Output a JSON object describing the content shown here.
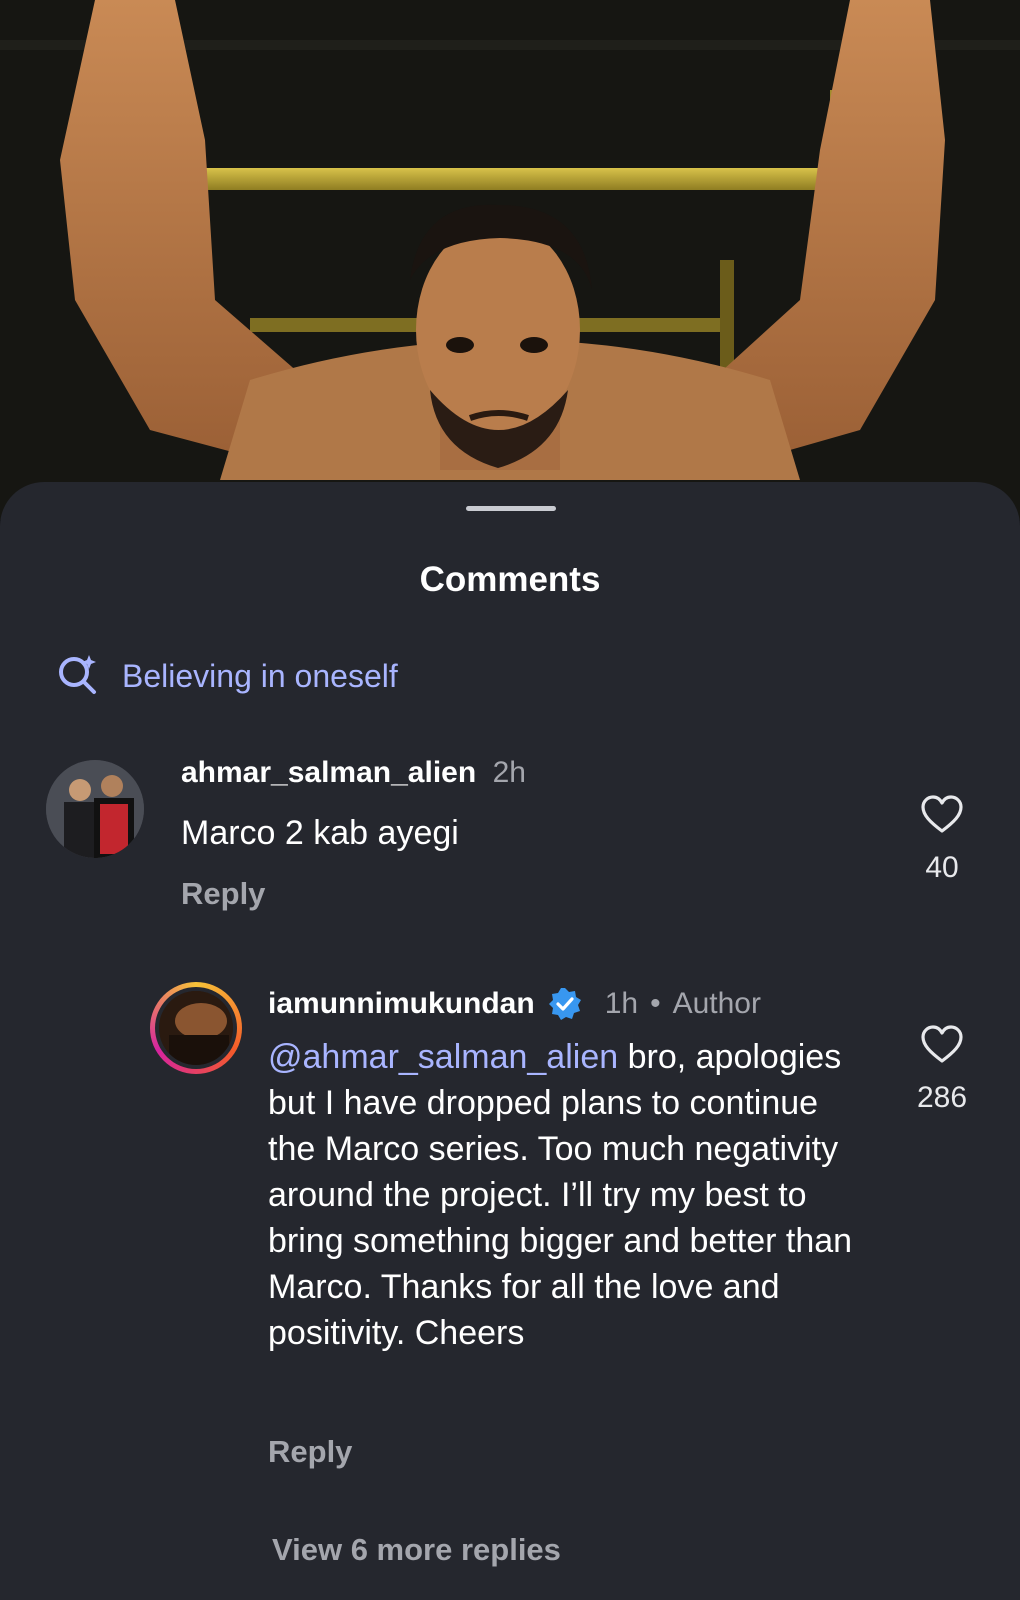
{
  "sheet": {
    "title": "Comments"
  },
  "search_suggestion": {
    "icon": "search-sparkle-icon",
    "text": "Believing in oneself"
  },
  "comments": [
    {
      "username": "ahmar_salman_alien",
      "time": "2h",
      "text": "Marco 2 kab ayegi",
      "reply_label": "Reply",
      "likes": "40"
    },
    {
      "username": "iamunnimukundan",
      "verified": true,
      "time": "1h",
      "separator": "•",
      "role": "Author",
      "mention": "@ahmar_salman_alien",
      "text": " bro, apologies but I have dropped plans to continue the Marco series. Too much negativity around the project. I’ll try my best to bring something bigger and better than Marco. Thanks for all the love and positivity. Cheers",
      "reply_label": "Reply",
      "likes": "286"
    }
  ],
  "view_more_replies": "View 6 more replies",
  "colors": {
    "sheet_bg": "#25272e",
    "accent_link": "#a9b5ff",
    "muted_text": "#a4a6ad",
    "verified_badge": "#3897f0"
  }
}
